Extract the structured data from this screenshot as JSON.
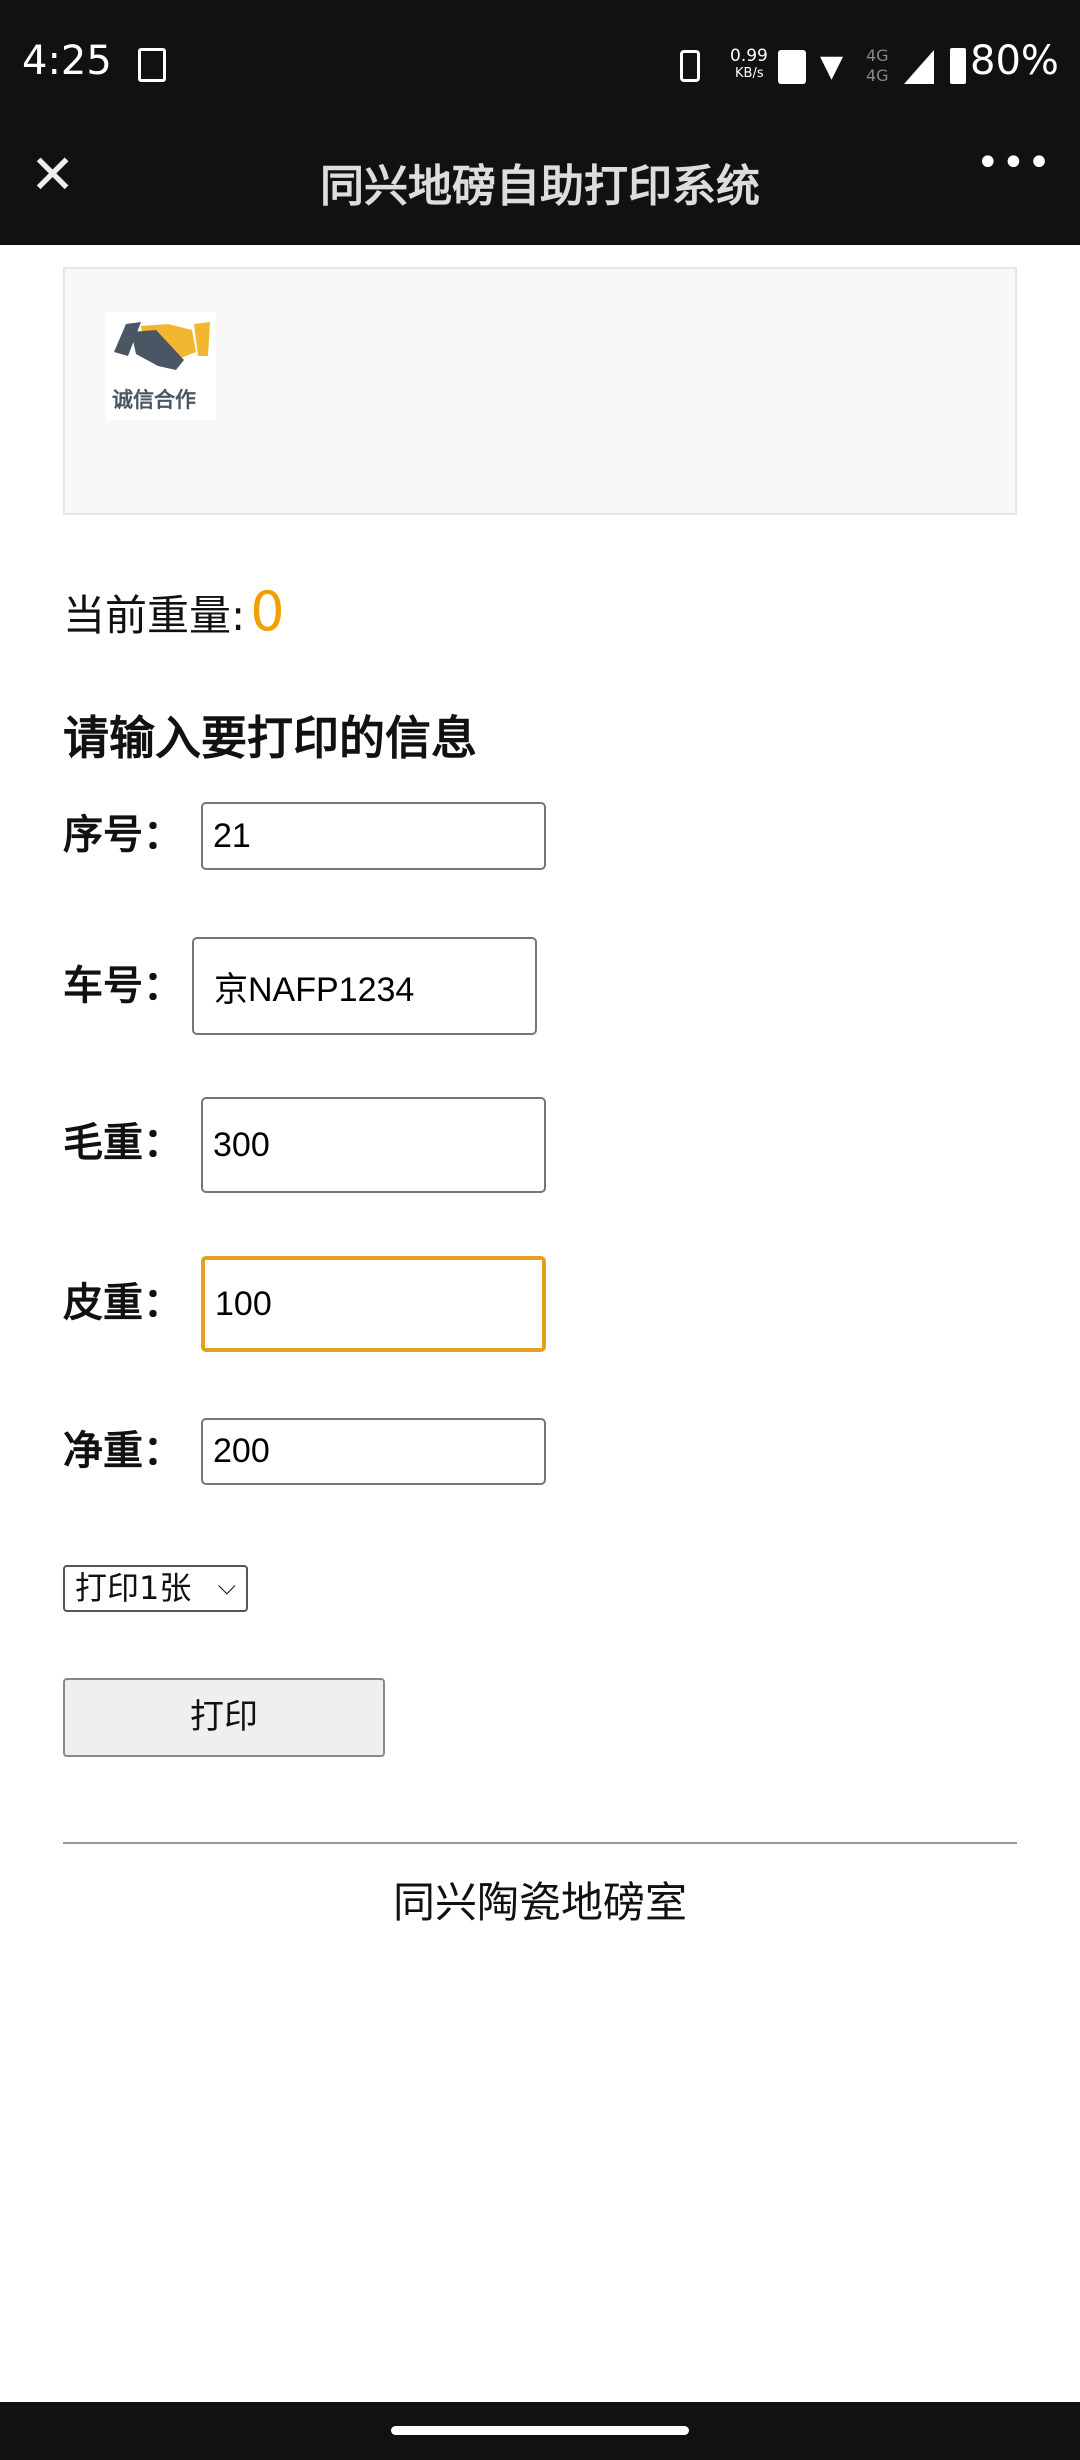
{
  "status_bar": {
    "time": "4:25",
    "net_speed": "0.99",
    "net_unit": "KB/s",
    "sig1": "4G",
    "sig2": "4G",
    "battery": "80%"
  },
  "title_bar": {
    "title": "同兴地磅自助打印系统"
  },
  "banner": {
    "logo_text": "诚信合作"
  },
  "weight": {
    "label": "当前重量:",
    "value": "0"
  },
  "form": {
    "heading": "请输入要打印的信息",
    "fields": [
      {
        "label": "序号：",
        "value": "21"
      },
      {
        "label": "车号：",
        "value": "京NAFP1234"
      },
      {
        "label": "毛重：",
        "value": "300"
      },
      {
        "label": "皮重：",
        "value": "100"
      },
      {
        "label": "净重：",
        "value": "200"
      }
    ],
    "copies_select": "打印1张",
    "print_button": "打印"
  },
  "footer": {
    "text": "同兴陶瓷地磅室"
  },
  "colors": {
    "accent": "#f0a000",
    "focus_border": "#e6a020",
    "bar_bg": "#111111"
  }
}
